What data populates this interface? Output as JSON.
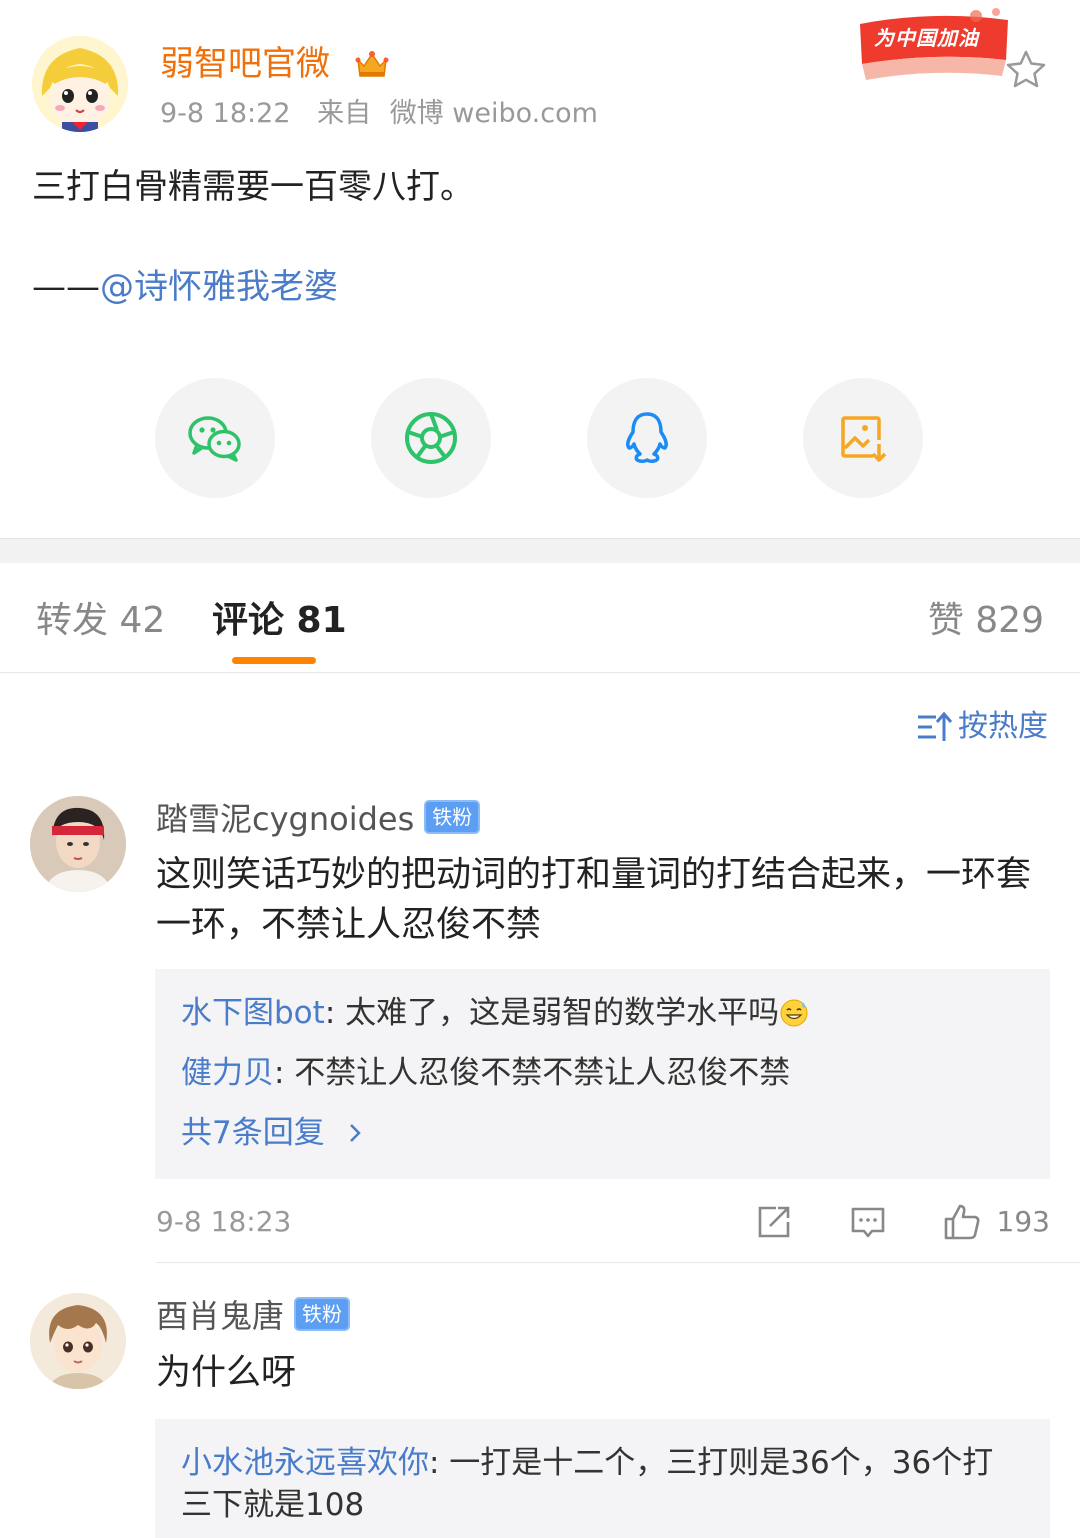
{
  "post": {
    "author": "弱智吧官微",
    "time": "9-8 18:22",
    "source_prefix": "来自",
    "source": "微博 weibo.com",
    "banner_text": "为中国加油",
    "body": "三打白骨精需要一百零八打。",
    "credit_prefix": "——",
    "credit_mention": "@诗怀雅我老婆"
  },
  "share_buttons": [
    {
      "icon": "wechat-icon",
      "color": "#2ec26a"
    },
    {
      "icon": "moments-icon",
      "color": "#2ec26a"
    },
    {
      "icon": "qq-icon",
      "color": "#1a8cf5"
    },
    {
      "icon": "save-image-icon",
      "color": "#f5a623"
    }
  ],
  "tabs": {
    "repost": "转发 42",
    "comments": "评论 81",
    "likes": "赞 829"
  },
  "sort": {
    "label": "按热度"
  },
  "comments": [
    {
      "user": "踏雪泥cygnoides",
      "badge": "铁粉",
      "text": "这则笑话巧妙的把动词的打和量词的打结合起来，一环套一环，不禁让人忍俊不禁",
      "replies": [
        {
          "user": "水下图bot",
          "text": ": 太难了，这是弱智的数学水平吗",
          "emoji": "grin-sweat-emoji"
        },
        {
          "user": "健力贝",
          "text": ": 不禁让人忍俊不禁不禁让人忍俊不禁"
        }
      ],
      "more_replies": "共7条回复",
      "time": "9-8 18:23",
      "likes": "193"
    },
    {
      "user": "酉肖鬼唐",
      "badge": "铁粉",
      "text": "为什么呀",
      "replies": [
        {
          "user": "小水池永远喜欢你",
          "text": ": 一打是十二个，三打则是36个，36个打",
          "text_cont": "三下就是108"
        }
      ]
    }
  ],
  "colors": {
    "accent_orange": "#ff8200",
    "link_blue": "#4a7cc9",
    "author_orange": "#f0700c"
  }
}
